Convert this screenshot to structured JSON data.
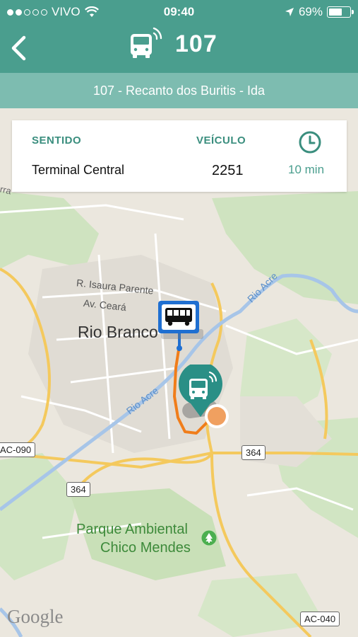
{
  "status_bar": {
    "carrier": "VIVO",
    "time": "09:40",
    "battery": "69%",
    "battery_level": 0.69
  },
  "nav": {
    "route_number": "107"
  },
  "subheader": {
    "route_name": "107 - Recanto dos Buritis - Ida"
  },
  "info_card": {
    "direction_label": "SENTIDO",
    "direction_value": "Terminal Central",
    "vehicle_label": "VEÍCULO",
    "vehicle_value": "2251",
    "eta_value": "10 min"
  },
  "map": {
    "labels": {
      "city": "Rio Branco",
      "street_1": "R. Isaura Parente",
      "street_2": "Av. Ceará",
      "river_1": "Rio Acre",
      "river_2": "Rio Acre",
      "park_line1": "Parque Ambiental",
      "park_line2": "Chico Mendes",
      "edge_text": "rra"
    },
    "shields": {
      "ac090": "AC-090",
      "br364_a": "364",
      "br364_b": "364",
      "ac040": "AC-040"
    },
    "attribution": "Google"
  },
  "colors": {
    "brand": "#4a9e8e",
    "route_line": "#f07d1a",
    "bus_stop_blue": "#1f6fd1"
  }
}
